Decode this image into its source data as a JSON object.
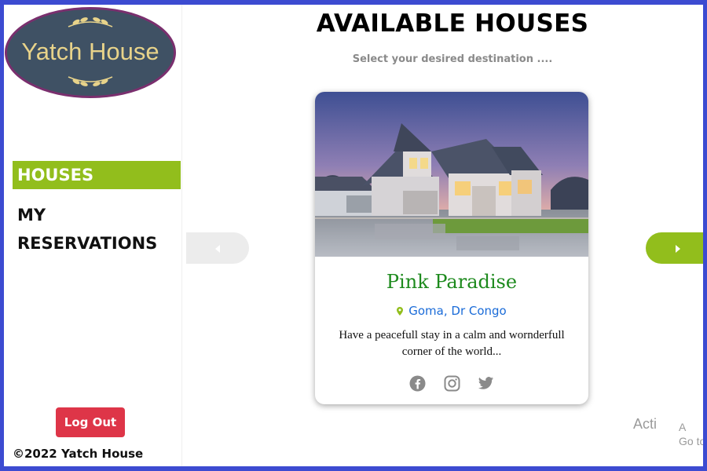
{
  "brand": {
    "logo_text": "Yatch House"
  },
  "sidebar": {
    "items": [
      {
        "label": "HOUSES",
        "active": true
      },
      {
        "label": "MY RESERVATIONS",
        "active": false
      }
    ],
    "logout_label": "Log Out",
    "copyright": "©2022 Yatch House"
  },
  "main": {
    "title": "AVAILABLE HOUSES",
    "subtitle": "Select your desired destination ....",
    "card": {
      "title": "Pink Paradise",
      "location": "Goma, Dr Congo",
      "description": "Have a peacefull stay in a calm and wornderfull corner of the world...",
      "socials": [
        "facebook-icon",
        "instagram-icon",
        "twitter-icon"
      ]
    }
  },
  "overlay": {
    "activate_text": "Acti",
    "activate_text2": "Go to",
    "activate_partial": "A"
  },
  "colors": {
    "accent_green": "#92be1c",
    "logout_red": "#de3548",
    "frame_blue": "#3c4bd1",
    "title_green": "#1d8a1d",
    "location_blue": "#1a6bd8"
  }
}
